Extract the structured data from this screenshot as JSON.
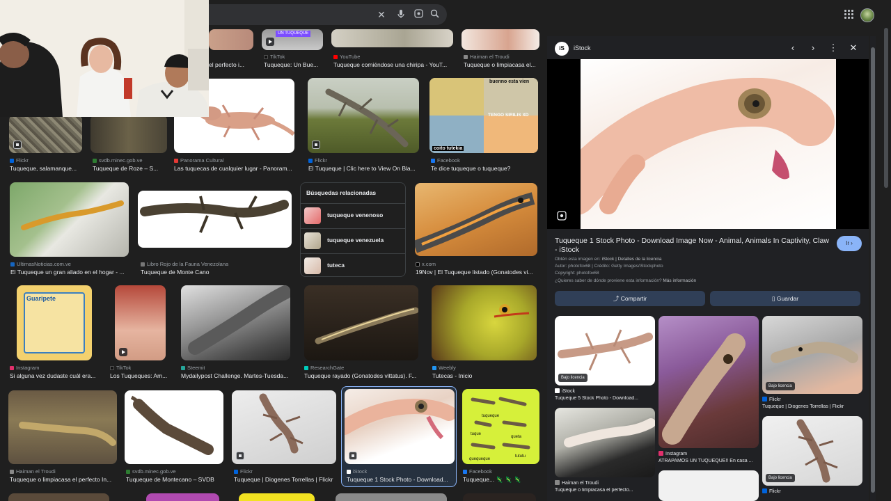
{
  "colors": {
    "background": "#1f1f1f",
    "panel": "#202124",
    "accent": "#8ab4f8",
    "button": "#303f57"
  },
  "top_tiles": [
    {
      "source": "",
      "title": "el perfecto i..."
    },
    {
      "source": "TikTok",
      "title": "Tuqueque: Un Bue...",
      "overlay_tag": "UN TUQUEQUE"
    },
    {
      "source": "YouTube",
      "title": "Tuqueque comiéndose una chiripa - YouT..."
    },
    {
      "source": "Haiman el Troudi",
      "title": "Tuqueque o limpiacasa el..."
    }
  ],
  "row2": [
    {
      "source": "Flickr",
      "title": "Tuqueque, salamanque..."
    },
    {
      "source": "svdb.minec.gob.ve",
      "title": "Tuqueque de Roze – S..."
    },
    {
      "source": "Panorama Cultural",
      "title": "Las tuquecas de cualquier lugar - Panoram..."
    },
    {
      "source": "Flickr",
      "title": "El Tuqueque | Clic here to View On Bla..."
    },
    {
      "source": "Facebook",
      "title": "Te dice tuqueque o tuqueque?",
      "meme_top": "buenno esta vien",
      "meme_mid": "TENGO SIRILIS XD",
      "meme_bottom": "coito tutekia"
    }
  ],
  "row3": [
    {
      "source": "UltimasNoticias.com.ve",
      "title": "El Tuqueque un gran aliado en el hogar - ..."
    },
    {
      "source": "Libro Rojo de la Fauna Venezolana",
      "title": "Tuqueque de Monte Cano"
    },
    {
      "source": "x.com",
      "title": "19Nov | El Tuqueque listado (Gonatodes vi..."
    }
  ],
  "related": {
    "heading": "Búsquedas relacionadas",
    "items": [
      "tuqueque venenoso",
      "tuqueque venezuela",
      "tuteca"
    ]
  },
  "row4": [
    {
      "source": "Instagram",
      "title": "Si alguna vez dudaste cuál era...",
      "card_heading": "Guaripete"
    },
    {
      "source": "TikTok",
      "title": "Los Tuqueques: Am..."
    },
    {
      "source": "Steemit",
      "title": "Mydailypost Challenge. Martes-Tuesda..."
    },
    {
      "source": "ResearchGate",
      "title": "Tuqueque rayado (Gonatodes vittatus). F..."
    },
    {
      "source": "Weebly",
      "title": "Tutecas - Inicio"
    }
  ],
  "row5": [
    {
      "source": "Haiman el Troudi",
      "title": "Tuqueque o limpiacasa el perfecto In..."
    },
    {
      "source": "svdb.minec.gob.ve",
      "title": "Tuqueque de Montecano – SVDB"
    },
    {
      "source": "Flickr",
      "title": "Tuqueque | Diogenes Torrellas | Flickr"
    },
    {
      "source": "iStock",
      "title": "Tuqueque 1 Stock Photo - Download..."
    },
    {
      "source": "Facebook",
      "title": "Tuqueque... 🦎 🦎 🦎",
      "labels": [
        "tuqueque",
        "tuque",
        "queta",
        "quequeque",
        "tututu"
      ]
    }
  ],
  "panel": {
    "source_icon": "iS",
    "source": "iStock",
    "title": "Tuqueque 1 Stock Photo - Download Image Now - Animal, Animals In Captivity, Claw - iStock",
    "go_label": "Ir ›",
    "meta_obtained_prefix": "Obtén esta imagen en:",
    "meta_obtained_link": "iStock | Detalles de la licencia",
    "meta_author": "Autor: photofox68 | Crédito: Getty Images/iStockphoto",
    "meta_copyright": "Copyright: photofox68",
    "meta_question": "¿Quieres saber de dónde proviene esta información?",
    "meta_more": "Más información",
    "share_label": "Compartir",
    "save_label": "Guardar",
    "license_label": "Bajo licencia",
    "results": [
      {
        "source": "iStock",
        "title": "Tuqueque 5 Stock Photo - Download..."
      },
      {
        "source": "Instagram",
        "title": "ATRAPAMOS UN TUQUEQUE!! En casa ..."
      },
      {
        "source": "Flickr",
        "title": "Tuqueque | Diogenes Torrellas | Flickr"
      },
      {
        "source": "Haiman el Troudi",
        "title": "Tuqueque o limpiacasa el perfecto..."
      },
      {
        "source": "Flickr",
        "title": ""
      }
    ]
  }
}
